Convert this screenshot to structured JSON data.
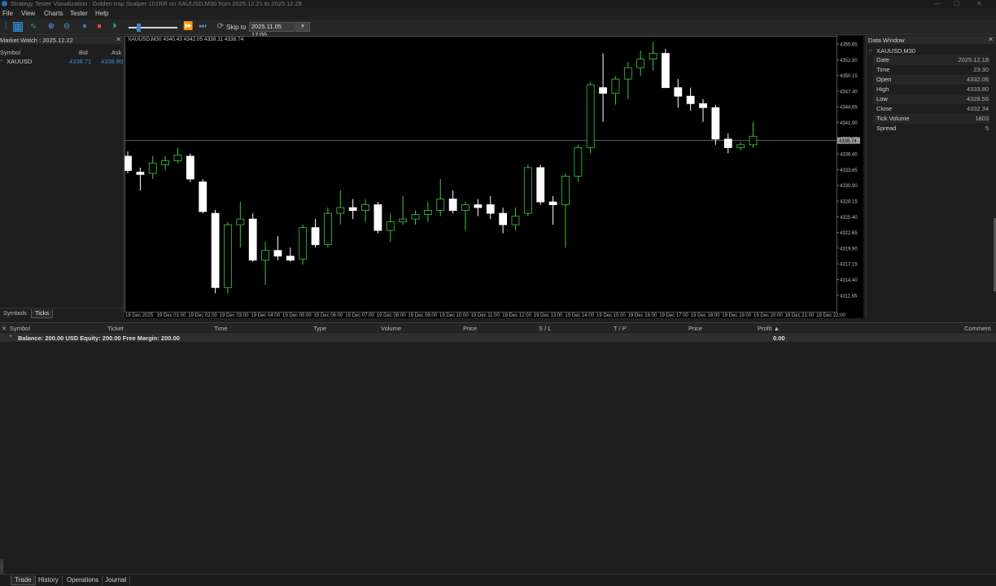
{
  "window": {
    "title": "Strategy Tester Visualization : Golden trap Scalper 101RR on XAUUSD,M30 from 2025.12.21 to 2025.12.28",
    "controls": [
      "—",
      "☐",
      "✕"
    ]
  },
  "menu": {
    "items": [
      "File",
      "View",
      "Charts",
      "Tester",
      "Help"
    ]
  },
  "toolbar": {
    "skip_label": "Skip to",
    "skip_value": "2025.11.05 17:00",
    "skip_button": "▾"
  },
  "market_watch": {
    "title": "Market Watch : 2025.12.22",
    "close": "✕",
    "columns": {
      "symbol": "Symbol",
      "bid": "Bid",
      "ask": "Ask"
    },
    "rows": [
      {
        "symbol": "XAUUSD",
        "bid": "4338.71",
        "ask": "4338.80"
      }
    ],
    "tabs": [
      "Symbols",
      "Ticks"
    ],
    "colors": {
      "price": "#3b8fd8"
    }
  },
  "chart": {
    "info": "XAUUSD,M30  4340.43 4342.05 4338.11 4338.74",
    "bid_label": "4338.74",
    "price_labels": [
      "4355.65",
      "4352.90",
      "4350.15",
      "4347.40",
      "4344.65",
      "4341.90",
      "4339.15",
      "4336.40",
      "4333.65",
      "4330.90",
      "4328.15",
      "4325.40",
      "4322.65",
      "4319.90",
      "4317.15",
      "4314.40",
      "4311.65"
    ],
    "time_labels": [
      "18 Dec 2025",
      "19 Dec 01:00",
      "19 Dec 02:00",
      "19 Dec 03:00",
      "19 Dec 04:00",
      "19 Dec 05:00",
      "19 Dec 06:00",
      "19 Dec 07:00",
      "19 Dec 08:00",
      "19 Dec 09:00",
      "19 Dec 10:00",
      "19 Dec 11:00",
      "19 Dec 12:00",
      "19 Dec 13:00",
      "19 Dec 14:00",
      "19 Dec 15:00",
      "19 Dec 16:00",
      "19 Dec 17:00",
      "19 Dec 18:00",
      "19 Dec 19:00",
      "19 Dec 20:00",
      "19 Dec 21:00",
      "19 Dec 22:00"
    ],
    "colors": {
      "background": "#000000",
      "bull_body": "#000000",
      "bull_wick": "#3cc83c",
      "bear_body": "#ffffff",
      "bear_wick": "#ffffff",
      "bid_line": "#888888"
    },
    "candles": [
      {
        "o": 4336.0,
        "h": 4336.8,
        "l": 4333.0,
        "c": 4333.5
      },
      {
        "o": 4333.2,
        "h": 4334.0,
        "l": 4330.0,
        "c": 4332.8
      },
      {
        "o": 4333.0,
        "h": 4336.0,
        "l": 4332.0,
        "c": 4334.8
      },
      {
        "o": 4334.5,
        "h": 4336.0,
        "l": 4333.5,
        "c": 4335.2
      },
      {
        "o": 4335.2,
        "h": 4337.5,
        "l": 4334.8,
        "c": 4336.2
      },
      {
        "o": 4336.0,
        "h": 4336.5,
        "l": 4331.5,
        "c": 4332.0
      },
      {
        "o": 4331.5,
        "h": 4332.0,
        "l": 4326.0,
        "c": 4326.3
      },
      {
        "o": 4326.0,
        "h": 4326.6,
        "l": 4312.0,
        "c": 4313.0
      },
      {
        "o": 4313.0,
        "h": 4324.5,
        "l": 4312.0,
        "c": 4324.0
      },
      {
        "o": 4324.0,
        "h": 4328.0,
        "l": 4320.0,
        "c": 4325.0
      },
      {
        "o": 4325.0,
        "h": 4326.0,
        "l": 4317.5,
        "c": 4317.8
      },
      {
        "o": 4317.8,
        "h": 4321.0,
        "l": 4313.5,
        "c": 4319.5
      },
      {
        "o": 4319.5,
        "h": 4322.0,
        "l": 4317.8,
        "c": 4318.5
      },
      {
        "o": 4318.5,
        "h": 4320.0,
        "l": 4317.5,
        "c": 4317.8
      },
      {
        "o": 4318.0,
        "h": 4324.0,
        "l": 4317.0,
        "c": 4323.5
      },
      {
        "o": 4323.5,
        "h": 4325.0,
        "l": 4320.0,
        "c": 4320.5
      },
      {
        "o": 4320.5,
        "h": 4327.0,
        "l": 4320.0,
        "c": 4326.0
      },
      {
        "o": 4326.0,
        "h": 4330.0,
        "l": 4324.0,
        "c": 4327.0
      },
      {
        "o": 4327.0,
        "h": 4328.5,
        "l": 4325.0,
        "c": 4326.5
      },
      {
        "o": 4326.5,
        "h": 4328.5,
        "l": 4324.5,
        "c": 4327.5
      },
      {
        "o": 4327.5,
        "h": 4328.0,
        "l": 4322.5,
        "c": 4323.0
      },
      {
        "o": 4323.0,
        "h": 4326.0,
        "l": 4321.0,
        "c": 4324.5
      },
      {
        "o": 4324.5,
        "h": 4329.0,
        "l": 4324.0,
        "c": 4325.0
      },
      {
        "o": 4325.0,
        "h": 4326.5,
        "l": 4324.0,
        "c": 4325.8
      },
      {
        "o": 4325.8,
        "h": 4328.0,
        "l": 4324.5,
        "c": 4326.5
      },
      {
        "o": 4326.5,
        "h": 4332.0,
        "l": 4325.5,
        "c": 4328.5
      },
      {
        "o": 4328.5,
        "h": 4330.0,
        "l": 4326.0,
        "c": 4326.5
      },
      {
        "o": 4326.5,
        "h": 4328.0,
        "l": 4323.0,
        "c": 4327.5
      },
      {
        "o": 4327.5,
        "h": 4328.5,
        "l": 4325.5,
        "c": 4327.0
      },
      {
        "o": 4327.5,
        "h": 4329.0,
        "l": 4325.0,
        "c": 4326.0
      },
      {
        "o": 4326.0,
        "h": 4327.0,
        "l": 4322.5,
        "c": 4324.0
      },
      {
        "o": 4324.0,
        "h": 4327.0,
        "l": 4323.0,
        "c": 4325.5
      },
      {
        "o": 4326.0,
        "h": 4334.5,
        "l": 4325.5,
        "c": 4334.0
      },
      {
        "o": 4334.0,
        "h": 4334.5,
        "l": 4327.5,
        "c": 4328.0
      },
      {
        "o": 4328.0,
        "h": 4329.0,
        "l": 4324.0,
        "c": 4327.5
      },
      {
        "o": 4327.5,
        "h": 4333.0,
        "l": 4320.0,
        "c": 4332.5
      },
      {
        "o": 4332.5,
        "h": 4338.0,
        "l": 4331.5,
        "c": 4337.5
      },
      {
        "o": 4337.5,
        "h": 4349.0,
        "l": 4336.5,
        "c": 4348.5
      },
      {
        "o": 4348.0,
        "h": 4354.0,
        "l": 4342.0,
        "c": 4347.0
      },
      {
        "o": 4347.0,
        "h": 4350.0,
        "l": 4345.0,
        "c": 4349.5
      },
      {
        "o": 4349.5,
        "h": 4352.5,
        "l": 4346.0,
        "c": 4351.5
      },
      {
        "o": 4351.5,
        "h": 4354.5,
        "l": 4350.0,
        "c": 4353.0
      },
      {
        "o": 4353.0,
        "h": 4356.0,
        "l": 4351.0,
        "c": 4354.0
      },
      {
        "o": 4354.0,
        "h": 4354.8,
        "l": 4350.0,
        "c": 4348.0
      },
      {
        "o": 4348.0,
        "h": 4349.5,
        "l": 4344.5,
        "c": 4346.5
      },
      {
        "o": 4346.5,
        "h": 4348.0,
        "l": 4344.0,
        "c": 4345.2
      },
      {
        "o": 4345.2,
        "h": 4346.0,
        "l": 4342.0,
        "c": 4344.5
      },
      {
        "o": 4344.5,
        "h": 4345.0,
        "l": 4338.0,
        "c": 4339.0
      },
      {
        "o": 4339.0,
        "h": 4340.0,
        "l": 4336.5,
        "c": 4337.5
      },
      {
        "o": 4337.5,
        "h": 4338.5,
        "l": 4337.0,
        "c": 4338.0
      },
      {
        "o": 4338.0,
        "h": 4342.0,
        "l": 4337.5,
        "c": 4339.5
      }
    ]
  },
  "data_window": {
    "title": "Data Window",
    "close": "✕",
    "symbol": "XAUUSD,M30",
    "rows": [
      {
        "k": "Date",
        "v": "2025.12.18"
      },
      {
        "k": "Time",
        "v": "23:30"
      },
      {
        "k": "Open",
        "v": "4332.06"
      },
      {
        "k": "High",
        "v": "4333.80"
      },
      {
        "k": "Low",
        "v": "4328.56"
      },
      {
        "k": "Close",
        "v": "4332.34"
      },
      {
        "k": "Tick Volume",
        "v": "1803"
      },
      {
        "k": "Spread",
        "v": "5"
      }
    ]
  },
  "toolbox": {
    "columns": [
      "Symbol",
      "Ticket",
      "Time",
      "Type",
      "Volume",
      "Price",
      "S / L",
      "T / P",
      "Price",
      "Profit ▲",
      "Comment"
    ],
    "balance": "Balance: 200.00 USD  Equity: 200.00  Free Margin: 200.00",
    "profit": "0.00",
    "tabs": [
      "Trade",
      "History",
      "Operations",
      "Journal"
    ],
    "side_label": "Toolbox"
  }
}
